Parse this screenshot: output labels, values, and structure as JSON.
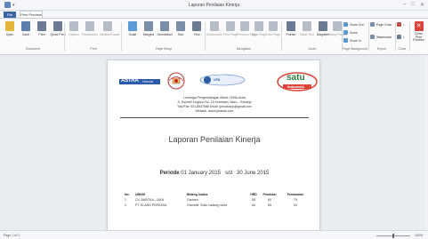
{
  "window": {
    "title": "Laporan Penilaian Kinerja",
    "qa_arrow": "▾",
    "controls": [
      "–",
      "□",
      "✕"
    ]
  },
  "tabs": {
    "file": "File",
    "print_preview": "Print Preview"
  },
  "ribbon": {
    "buttons": [
      {
        "name": "open-button",
        "label": "Open",
        "icon": "folder-icon",
        "color": "#e3b53a"
      },
      {
        "name": "save-button",
        "label": "Save",
        "icon": "save-icon",
        "color": "#5d7fae"
      },
      {
        "name": "print-button",
        "label": "Print",
        "icon": "print-icon",
        "color": "#6b7c92"
      },
      {
        "name": "quick-print-button",
        "label": "Quick Print",
        "icon": "quick-print-icon",
        "color": "#6b7c92"
      },
      {
        "name": "options-button",
        "label": "Options",
        "icon": "options-icon",
        "color": "#b6bdc7",
        "disabled": true
      },
      {
        "name": "parameters-button",
        "label": "Parameters",
        "icon": "parameters-icon",
        "color": "#b6bdc7",
        "disabled": true
      },
      {
        "name": "header-footer-button",
        "label": "Header/Footer",
        "icon": "header-footer-icon",
        "color": "#b6bdc7",
        "disabled": true
      },
      {
        "name": "scale-button",
        "label": "Scale",
        "icon": "scale-icon",
        "color": "#5b9bd5"
      },
      {
        "name": "margins-button",
        "label": "Margins",
        "icon": "margins-icon",
        "color": "#7a8ea8"
      },
      {
        "name": "orientation-button",
        "label": "Orientation",
        "icon": "orientation-icon",
        "color": "#7a8ea8"
      },
      {
        "name": "size-button",
        "label": "Size",
        "icon": "size-icon",
        "color": "#7a8ea8"
      },
      {
        "name": "find-button",
        "label": "Find",
        "icon": "binoculars-icon",
        "color": "#6b7c92"
      },
      {
        "name": "bookmarks-button",
        "label": "Bookmarks",
        "icon": "bookmarks-icon",
        "color": "#b6bdc7",
        "disabled": true
      },
      {
        "name": "first-page-button",
        "label": "First Page",
        "icon": "first-page-icon",
        "color": "#b6bdc7",
        "disabled": true
      },
      {
        "name": "previous-page-button",
        "label": "Previous Page",
        "icon": "previous-page-icon",
        "color": "#b6bdc7",
        "disabled": true
      },
      {
        "name": "next-page-button",
        "label": "Next Page",
        "icon": "next-page-icon",
        "color": "#b6bdc7",
        "disabled": true
      },
      {
        "name": "last-page-button",
        "label": "Last Page",
        "icon": "last-page-icon",
        "color": "#b6bdc7",
        "disabled": true
      },
      {
        "name": "pointer-button",
        "label": "Pointer",
        "icon": "pointer-icon",
        "color": "#6b7c92"
      },
      {
        "name": "hand-tool-button",
        "label": "Hand Tool",
        "icon": "hand-icon",
        "color": "#b6bdc7",
        "disabled": true
      },
      {
        "name": "magnifier-button",
        "label": "Magnifier",
        "icon": "magnifier-icon",
        "color": "#6b7c92"
      },
      {
        "name": "many-pages-button",
        "label": "Many Pages",
        "icon": "many-pages-icon",
        "color": "#b6bdc7",
        "disabled": true
      }
    ],
    "zoom_items": [
      {
        "name": "zoom-out-button",
        "label": "Zoom Out",
        "icon": "zoom-out-icon"
      },
      {
        "name": "zoom-button",
        "label": "Zoom",
        "icon": "zoom-icon"
      },
      {
        "name": "zoom-in-button",
        "label": "Zoom In",
        "icon": "zoom-in-icon"
      }
    ],
    "background_items": [
      {
        "name": "page-color-button",
        "label": "Page Color",
        "icon": "page-color-icon"
      },
      {
        "name": "watermark-button",
        "label": "Watermark",
        "icon": "watermark-icon"
      }
    ],
    "export_items": [
      {
        "name": "export-button",
        "label": "",
        "icon": "export-icon"
      },
      {
        "name": "email-button",
        "label": "",
        "icon": "email-icon"
      }
    ],
    "close_button": {
      "label": "Close Print Preview",
      "color": "#d9433a"
    },
    "groups": [
      "Document",
      "Print",
      "Page Setup",
      "Navigation",
      "Zoom",
      "Page Background",
      "Export",
      "Close"
    ]
  },
  "document": {
    "org_lines": [
      "Lembaga Pengembangan Bisnis YDBA Astra",
      "Jl. Kolonel Sugiono No. 15 Kureksari, Waru - Sidoarjo",
      "Telp/Fax: 031-8547588 Email: lpbsidoarjo@gmail.com",
      "Website: www.lpbastra.com"
    ],
    "logos": {
      "astra": "ASTRA",
      "astra_suffix": "Honda",
      "lpb": "LPB",
      "satu": "satu",
      "satu_suffix": "Indonesia"
    },
    "report_title": "Laporan Penilaian Kinerja",
    "period_label": "Periode",
    "period_start": "01 January 2015",
    "period_sep": "s/d",
    "period_end": "30 June 2015",
    "table": {
      "headers": [
        "No.",
        "UMKM",
        "Bidang Usaha",
        "HRD",
        "Produksi",
        "Pemasaran"
      ],
      "rows": [
        [
          "1.",
          "CV. BARCKA - JAYA",
          "Garmen",
          "58",
          "60",
          "75"
        ],
        [
          "2.",
          "PT. ELANG PERKASA",
          "Otomotif, Suku cadang motor",
          "60",
          "65",
          "63"
        ]
      ]
    }
  },
  "statusbar": {
    "page_info": "Page 1 of 1",
    "zoom": "100%"
  },
  "colors": {
    "accent": "#3a66a8",
    "close": "#d9433a"
  }
}
